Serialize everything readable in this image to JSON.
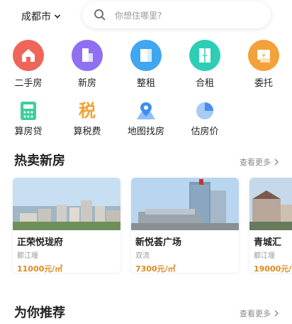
{
  "header": {
    "city": "成都市",
    "search_placeholder": "你想住哪里?"
  },
  "categories": [
    {
      "label": "二手房",
      "icon": "house-icon",
      "color": "#f0655a"
    },
    {
      "label": "新房",
      "icon": "building-icon",
      "color": "#8f6ff2"
    },
    {
      "label": "整租",
      "icon": "apartment-icon",
      "color": "#3fa6f1"
    },
    {
      "label": "合租",
      "icon": "door-icon",
      "color": "#2ecdb6"
    },
    {
      "label": "委托",
      "icon": "commission-icon",
      "color": "#f3a13a"
    }
  ],
  "tools": [
    {
      "label": "算房贷",
      "icon": "calculator-icon",
      "color": "#3ccf9e"
    },
    {
      "label": "算税费",
      "icon": "tax-icon",
      "glyph": "税",
      "color": "#f0a234"
    },
    {
      "label": "地图找房",
      "icon": "map-pin-icon",
      "color": "#3f8ef2"
    },
    {
      "label": "估房价",
      "icon": "pie-chart-icon",
      "color": "#4a8df0"
    }
  ],
  "hot": {
    "title": "热卖新房",
    "more": "查看更多",
    "cards": [
      {
        "name": "正荣悦珑府",
        "area": "都江堰",
        "price": "11000元/㎡"
      },
      {
        "name": "新悦荟广场",
        "area": "双流",
        "price": "7300元/㎡"
      },
      {
        "name": "青城汇",
        "area": "都江堰",
        "price": "19000元/㎡"
      }
    ]
  },
  "recommend": {
    "title": "为你推荐",
    "more": "查看更多"
  }
}
